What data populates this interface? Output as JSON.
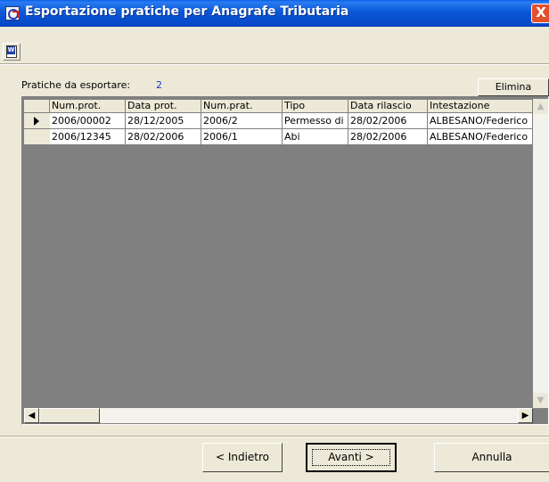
{
  "window": {
    "title": "Esportazione pratiche per Anagrafe Tributaria",
    "close_label": "X"
  },
  "toolbar": {
    "word_icon": "word-document-icon"
  },
  "summary": {
    "label": "Pratiche da esportare:",
    "count": "2"
  },
  "elimina_label": "Elimina",
  "grid": {
    "columns": [
      "Num.prot.",
      "Data prot.",
      "Num.prat.",
      "Tipo",
      "Data rilascio",
      "Intestazione"
    ],
    "rows": [
      [
        "2006/00002",
        "28/12/2005",
        "2006/2",
        "Permesso di",
        "28/02/2006",
        "ALBESANO/Federico"
      ],
      [
        "2006/12345",
        "28/02/2006",
        "2006/1",
        "Abi",
        "28/02/2006",
        "ALBESANO/Federico"
      ]
    ],
    "selected_row": 0
  },
  "buttons": {
    "back": "< Indietro",
    "next": "Avanti >",
    "cancel": "Annulla"
  },
  "colors": {
    "title_bar": "#0a5fe8",
    "count_text": "#1c2fd2",
    "window_bg": "#ece9d8"
  }
}
